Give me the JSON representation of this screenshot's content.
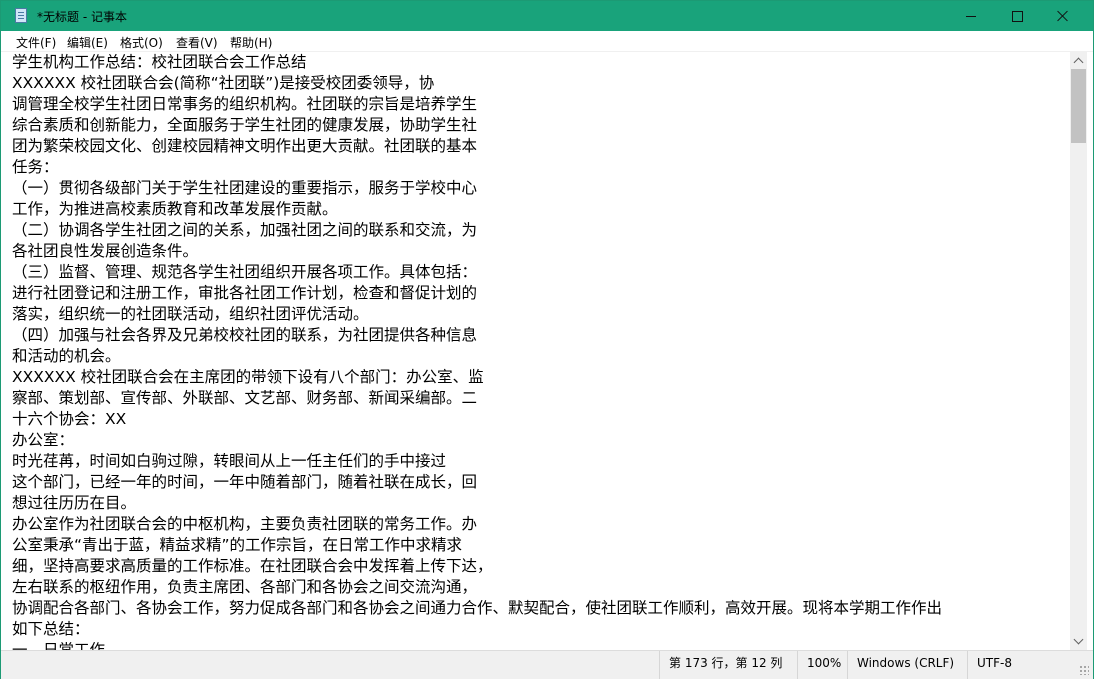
{
  "window": {
    "title": "*无标题 - 记事本"
  },
  "menu": [
    "文件(F)",
    "编辑(E)",
    "格式(O)",
    "查看(V)",
    "帮助(H)"
  ],
  "editor": {
    "lines": [
      "学生机构工作总结：校社团联合会工作总结",
      "XXXXXX 校社团联合会(简称“社团联”)是接受校团委领导，协",
      "调管理全校学生社团日常事务的组织机构。社团联的宗旨是培养学生",
      "综合素质和创新能力，全面服务于学生社团的健康发展，协助学生社",
      "团为繁荣校园文化、创建校园精神文明作出更大贡献。社团联的基本",
      "任务：",
      "（一）贯彻各级部门关于学生社团建设的重要指示，服务于学校中心",
      "工作，为推进高校素质教育和改革发展作贡献。",
      "（二）协调各学生社团之间的关系，加强社团之间的联系和交流，为",
      "各社团良性发展创造条件。",
      "（三）监督、管理、规范各学生社团组织开展各项工作。具体包括：",
      "进行社团登记和注册工作，审批各社团工作计划，检查和督促计划的",
      "落实，组织统一的社团联活动，组织社团评优活动。",
      "（四）加强与社会各界及兄弟校校社团的联系，为社团提供各种信息",
      "和活动的机会。",
      "XXXXXX 校社团联合会在主席团的带领下设有八个部门：办公室、监",
      "察部、策划部、宣传部、外联部、文艺部、财务部、新闻采编部。二",
      "十六个协会：XX",
      "办公室：",
      "时光荏苒，时间如白驹过隙，转眼间从上一任主任们的手中接过",
      "这个部门，已经一年的时间，一年中随着部门，随着社联在成长，回",
      "想过往历历在目。",
      "办公室作为社团联合会的中枢机构，主要负责社团联的常务工作。办",
      "公室秉承“青出于蓝，精益求精”的工作宗旨，在日常工作中求精求",
      "细，坚持高要求高质量的工作标准。在社团联合会中发挥着上传下达，",
      "左右联系的枢纽作用，负责主席团、各部门和各协会之间交流沟通，",
      "协调配合各部门、各协会工作，努力促成各部门和各协会之间通力合作、默契配合，使社团联工作顺利，高效开展。现将本学期工作作出",
      "如下总结：",
      "一、日常工作"
    ]
  },
  "status": {
    "position": "第 173 行，第 12 列",
    "zoom": "100%",
    "line_ending": "Windows (CRLF)",
    "encoding": "UTF-8"
  }
}
